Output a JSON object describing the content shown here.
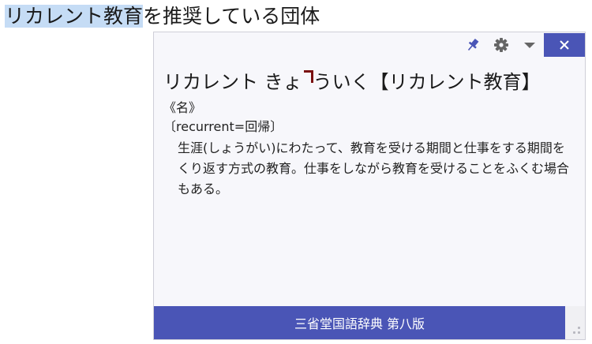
{
  "document": {
    "selected_text": "リカレント教育",
    "rest_text": "を推奨している団体"
  },
  "popup": {
    "toolbar": {
      "pin_icon": "pin-icon",
      "settings_icon": "gear-icon",
      "dropdown_icon": "chevron-down-icon",
      "close_icon": "close-icon"
    },
    "entry": {
      "reading_before_accent": "リカレント きょ",
      "reading_after_accent": "ういく",
      "headword": "【リカレント教育】",
      "part_of_speech": "《名》",
      "etymology": "〔recurrent=回帰〕",
      "definition": "生涯(しょうがい)にわたって、教育を受ける期間と仕事をする期間をくり返す方式の教育。仕事をしながら教育を受けることをふくむ場合もある。"
    },
    "footer": {
      "dictionary_name": "三省堂国語辞典 第八版"
    },
    "colors": {
      "accent": "#4a55b6",
      "selection": "#c5dcf5",
      "pitch_mark": "#7a1010"
    }
  }
}
